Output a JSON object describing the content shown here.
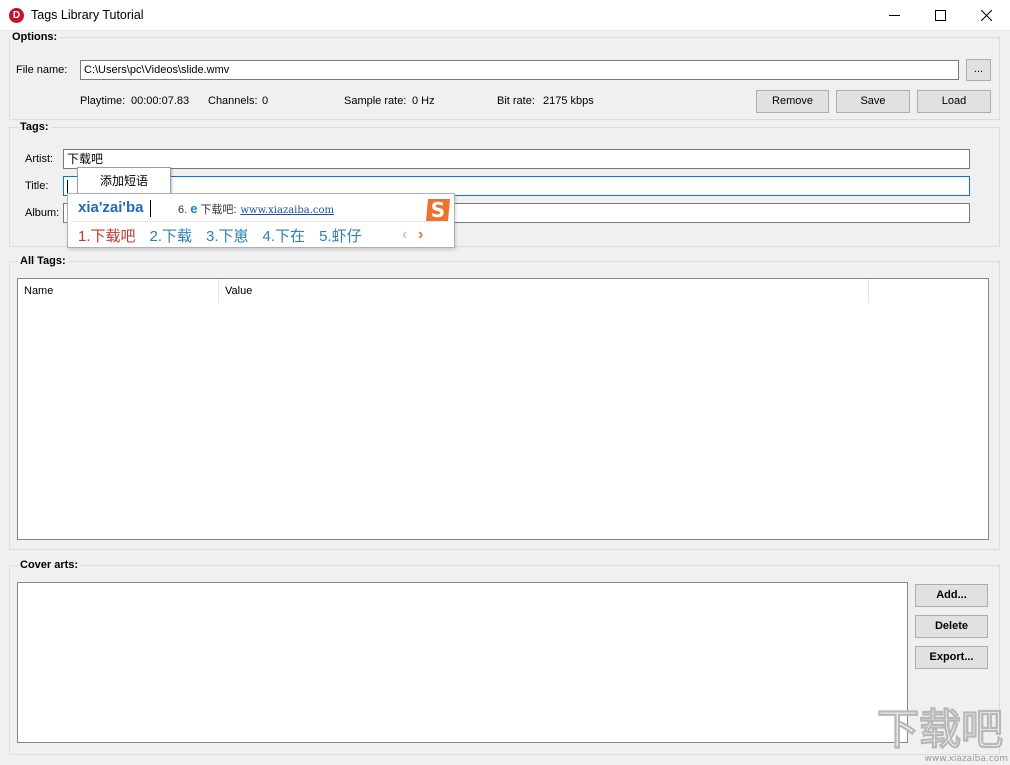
{
  "window": {
    "title": "Tags Library Tutorial",
    "icon_letter": "D"
  },
  "options": {
    "group_label": "Options:",
    "file_name_label": "File name:",
    "file_name_value": "C:\\Users\\pc\\Videos\\slide.wmv",
    "browse_label": "...",
    "playtime_label": "Playtime:",
    "playtime_value": "00:00:07.83",
    "channels_label": "Channels:",
    "channels_value": "0",
    "sample_rate_label": "Sample rate:",
    "sample_rate_value": "0 Hz",
    "bit_rate_label": "Bit rate:",
    "bit_rate_value": "2175 kbps",
    "remove_label": "Remove",
    "save_label": "Save",
    "load_label": "Load"
  },
  "tags": {
    "group_label": "Tags:",
    "artist_label": "Artist:",
    "artist_value": "下载吧",
    "title_label": "Title:",
    "title_value": "",
    "album_label": "Album:",
    "album_value": ""
  },
  "all_tags": {
    "group_label": "All Tags:",
    "columns": [
      "Name",
      "Value"
    ]
  },
  "cover_arts": {
    "group_label": "Cover arts:",
    "add_label": "Add...",
    "delete_label": "Delete",
    "export_label": "Export..."
  },
  "context_menu": {
    "item": "添加短语"
  },
  "ime": {
    "pinyin": "xia'zai'ba",
    "suggestion_index": "6.",
    "suggestion_text": "下载吧:",
    "suggestion_url": "www.xiazaiba.com",
    "candidates": [
      "1.下载吧",
      "2.下载",
      "3.下崽",
      "4.下在",
      "5.虾仔"
    ],
    "prev_arrow": "‹",
    "next_arrow": "›",
    "logo_letter": "S"
  },
  "watermark": {
    "text": "下载吧",
    "url": "www.xiazaiba.com"
  },
  "colors": {
    "accent": "#0078d7",
    "ime_pinyin": "#1e6bc0",
    "ime_first_candidate": "#c0392b",
    "ime_candidate": "#2c7fb8",
    "ime_logo": "#f07030"
  }
}
